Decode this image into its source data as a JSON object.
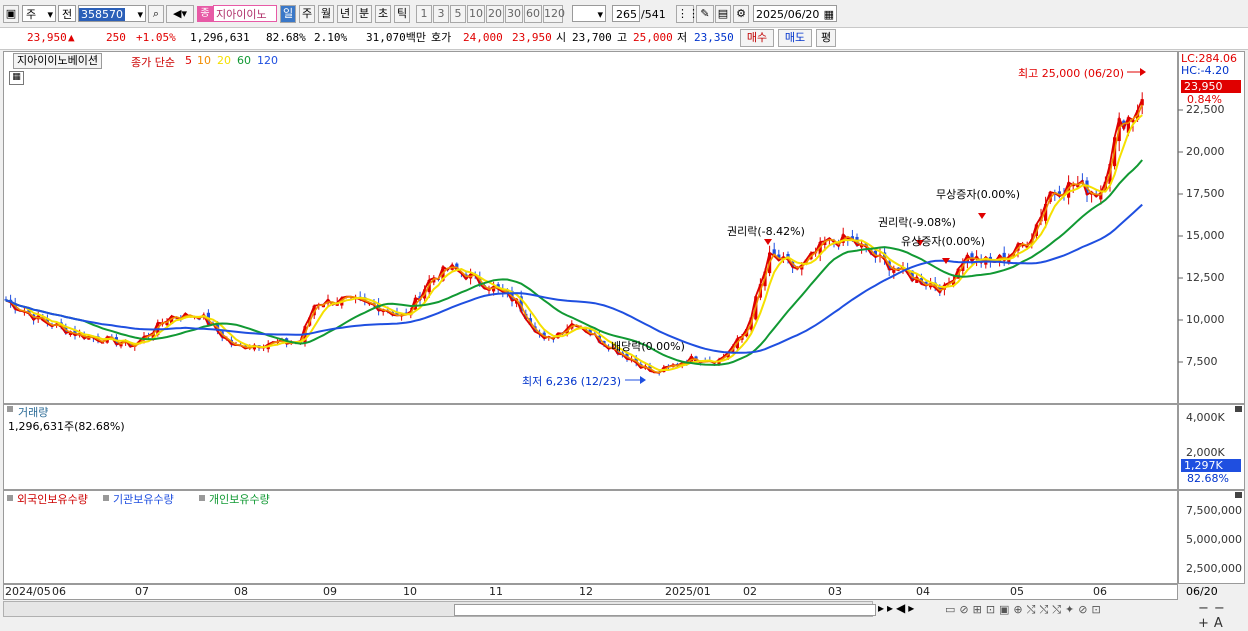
{
  "toolbar": {
    "market_type": "주",
    "prev_label": "전",
    "code": "358570",
    "stock_name": "지아이이노",
    "periods": [
      "일",
      "주",
      "월",
      "년",
      "분",
      "초",
      "틱"
    ],
    "intervals": [
      "1",
      "3",
      "5",
      "10",
      "20",
      "30",
      "60",
      "120"
    ],
    "count": "265",
    "total": "/541",
    "date": "2025/06/20"
  },
  "quote": {
    "price": "23,950",
    "arrow": "▲",
    "change": "250",
    "change_pct": "+1.05%",
    "volume": "1,296,631",
    "vol_ratio": "82.68%",
    "turnover": "2.10%",
    "amount": "31,070백만",
    "bid_label": "호가",
    "bid": "24,000",
    "ask": "23,950",
    "open_label": "시",
    "open": "23,700",
    "high_label": "고",
    "high": "25,000",
    "low_label": "저",
    "low": "23,350",
    "buy_label": "매수",
    "sell_label": "매도",
    "eval_label": "평"
  },
  "price_panel": {
    "stock_label": "지아이이노베이션",
    "ma_label": "종가 단순",
    "ma_periods": [
      "5",
      "10",
      "20",
      "60",
      "120"
    ],
    "ma_colors": [
      "#dd0000",
      "#f08c00",
      "#f5e000",
      "#119933",
      "#1f4fe0"
    ],
    "lc": "LC:284.06",
    "hc": "HC:-4.20",
    "price_badge": "23,950",
    "pct_badge": "0.84%",
    "y_ticks": [
      "22,500",
      "20,000",
      "17,500",
      "15,000",
      "12,500",
      "10,000",
      "7,500"
    ],
    "high_note": "최고 25,000 (06/20)",
    "low_note": "최저 6,236 (12/23)",
    "events": [
      "권리락(-8.42%)",
      "권리락(-9.08%)",
      "유상증자(0.00%)",
      "무상증자(0.00%)",
      "배당락(0.00%)"
    ]
  },
  "volume_panel": {
    "title": "거래량",
    "value": "1,296,631주(82.68%)",
    "y_ticks": [
      "4,000K",
      "2,000K"
    ],
    "badge": "1,297K",
    "badge_pct": "82.68%"
  },
  "holding_panel": {
    "legend": [
      "외국인보유수량",
      "기관보유수량",
      "개인보유수량"
    ],
    "y_ticks": [
      "7,500,000",
      "5,000,000",
      "2,500,000"
    ]
  },
  "x_axis": {
    "labels": [
      "2024/05",
      "06",
      "07",
      "08",
      "09",
      "10",
      "11",
      "12",
      "2025/01",
      "02",
      "03",
      "04",
      "05",
      "06"
    ],
    "end_date": "06/20"
  }
}
